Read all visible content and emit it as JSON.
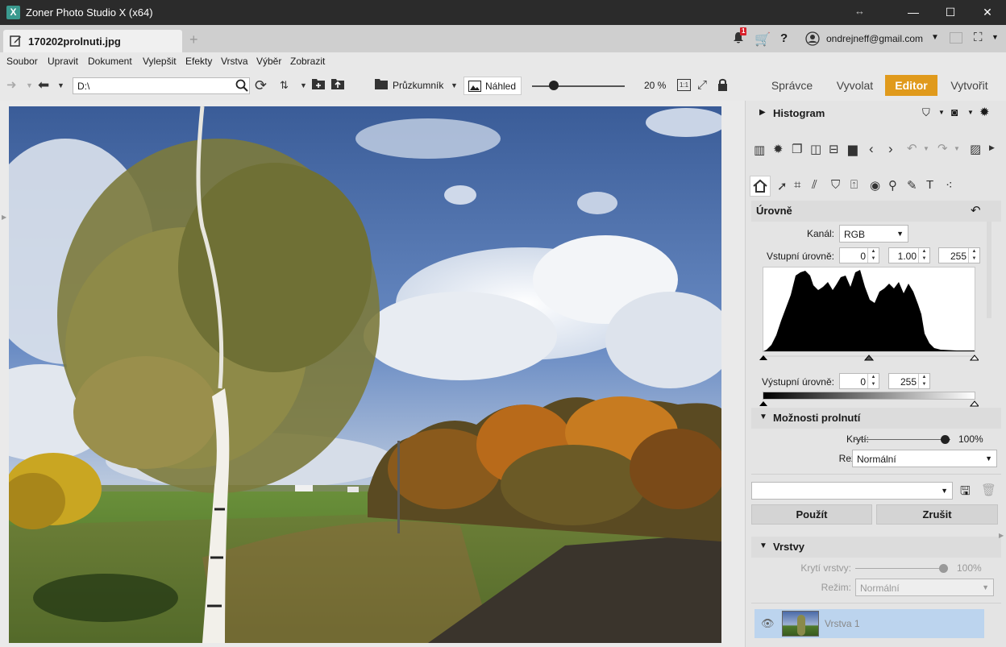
{
  "window": {
    "title": "Zoner Photo Studio X (x64)",
    "app_icon_glyph": "X",
    "controls": [
      "minimize-icon",
      "maximize-icon",
      "close-icon"
    ]
  },
  "tabs": {
    "document_tab": "170202prolnuti.jpg",
    "add_tab": "+"
  },
  "topright": {
    "notification_count": "1",
    "help": "?",
    "account": "ondrejneff@gmail.com"
  },
  "menu": [
    "Soubor",
    "Upravit",
    "Dokument",
    "Vylepšit",
    "Efekty",
    "Vrstva",
    "Výběr",
    "Zobrazit"
  ],
  "toolbar": {
    "path": "D:\\",
    "pruzkumnik": "Průzkumník",
    "nahled": "Náhled",
    "zoom": "20 %",
    "zoom_level": 0.2,
    "one_to_one": "1:1"
  },
  "modes": [
    {
      "label": "Správce",
      "active": false
    },
    {
      "label": "Vyvolat",
      "active": false
    },
    {
      "label": "Editor",
      "active": true
    },
    {
      "label": "Vytvořit",
      "active": false
    }
  ],
  "panel": {
    "histogram_title": "Histogram",
    "levels_title": "Úrovně",
    "channel_label": "Kanál:",
    "channel_value": "RGB",
    "input_levels_label": "Vstupní úrovně:",
    "input_black": "0",
    "input_gamma": "1.00",
    "input_white": "255",
    "output_levels_label": "Výstupní úrovně:",
    "output_black": "0",
    "output_white": "255",
    "blend_title": "Možnosti prolnutí",
    "opacity_label": "Krytí:",
    "opacity_value": "100%",
    "mode_label": "Režim:",
    "mode_value": "Normální",
    "apply_label": "Použít",
    "cancel_label": "Zrušit",
    "layers_title": "Vrstvy",
    "layer_opacity_label": "Krytí vrstvy:",
    "layer_opacity_value": "100%",
    "layer_mode_label": "Režim:",
    "layer_mode_value": "Normální",
    "layer_name": "Vrstva 1"
  },
  "colors": {
    "accent": "#e09a1c",
    "titlebar": "#2b2b2b",
    "selected_layer": "#bcd4ee"
  }
}
